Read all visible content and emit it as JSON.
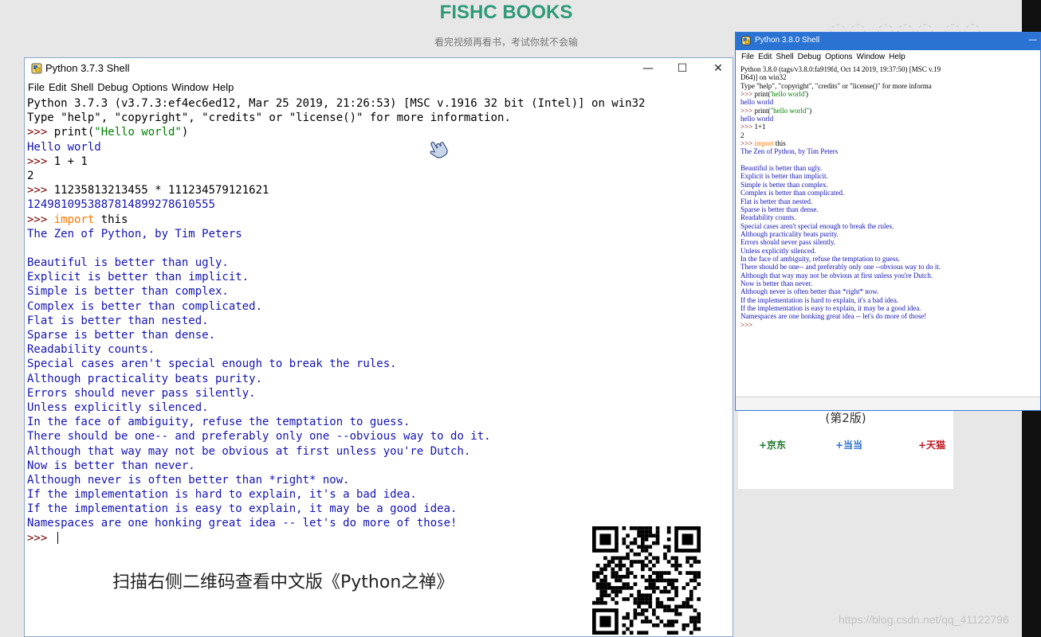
{
  "site": {
    "title": "FISHC BOOKS",
    "subtitle": "看完视频再看书，考试你就不会输"
  },
  "main_window": {
    "title": "Python 3.7.3 Shell",
    "controls": {
      "minimize": "—",
      "maximize": "☐",
      "close": "✕"
    },
    "menu": [
      "File",
      "Edit",
      "Shell",
      "Debug",
      "Options",
      "Window",
      "Help"
    ],
    "lines": [
      {
        "t": "plain",
        "text": "Python 3.7.3 (v3.7.3:ef4ec6ed12, Mar 25 2019, 21:26:53) [MSC v.1916 32 bit (Intel)] on win32"
      },
      {
        "t": "plain",
        "text": "Type \"help\", \"copyright\", \"credits\" or \"license()\" for more information."
      },
      {
        "t": "cmd",
        "prompt": ">>> ",
        "pre": "print(",
        "str": "\"Hello world\"",
        "post": ")"
      },
      {
        "t": "out",
        "text": "Hello world"
      },
      {
        "t": "in",
        "prompt": ">>> ",
        "text": "1 + 1"
      },
      {
        "t": "plain",
        "text": "2"
      },
      {
        "t": "in",
        "prompt": ">>> ",
        "text": "11235813213455 * 111234579121621"
      },
      {
        "t": "out",
        "text": "1249810953887814899278610555"
      },
      {
        "t": "kw",
        "prompt": ">>> ",
        "kw": "import",
        "text": " this"
      },
      {
        "t": "out",
        "text": "The Zen of Python, by Tim Peters"
      },
      {
        "t": "out",
        "text": ""
      },
      {
        "t": "out",
        "text": "Beautiful is better than ugly."
      },
      {
        "t": "out",
        "text": "Explicit is better than implicit."
      },
      {
        "t": "out",
        "text": "Simple is better than complex."
      },
      {
        "t": "out",
        "text": "Complex is better than complicated."
      },
      {
        "t": "out",
        "text": "Flat is better than nested."
      },
      {
        "t": "out",
        "text": "Sparse is better than dense."
      },
      {
        "t": "out",
        "text": "Readability counts."
      },
      {
        "t": "out",
        "text": "Special cases aren't special enough to break the rules."
      },
      {
        "t": "out",
        "text": "Although practicality beats purity."
      },
      {
        "t": "out",
        "text": "Errors should never pass silently."
      },
      {
        "t": "out",
        "text": "Unless explicitly silenced."
      },
      {
        "t": "out",
        "text": "In the face of ambiguity, refuse the temptation to guess."
      },
      {
        "t": "out",
        "text": "There should be one-- and preferably only one --obvious way to do it."
      },
      {
        "t": "out",
        "text": "Although that way may not be obvious at first unless you're Dutch."
      },
      {
        "t": "out",
        "text": "Now is better than never."
      },
      {
        "t": "out",
        "text": "Although never is often better than *right* now."
      },
      {
        "t": "out",
        "text": "If the implementation is hard to explain, it's a bad idea."
      },
      {
        "t": "out",
        "text": "If the implementation is easy to explain, it may be a good idea."
      },
      {
        "t": "out",
        "text": "Namespaces are one honking great idea -- let's do more of those!"
      },
      {
        "t": "prompt",
        "prompt": ">>> "
      }
    ]
  },
  "caption": "扫描右侧二维码查看中文版《Python之禅》",
  "second_window": {
    "title": "Python 3.8.0 Shell",
    "menu": [
      "File",
      "Edit",
      "Shell",
      "Debug",
      "Options",
      "Window",
      "Help"
    ],
    "lines": [
      {
        "t": "plain",
        "text": "Python 3.8.0 (tags/v3.8.0:fa919fd, Oct 14 2019, 19:37:50) [MSC v.19"
      },
      {
        "t": "plain",
        "text": "D64)] on win32"
      },
      {
        "t": "plain",
        "text": "Type \"help\", \"copyright\", \"credits\" or \"license()\" for more informa"
      },
      {
        "t": "cmd",
        "prompt": ">>> ",
        "pre": "print(",
        "str": "'hello world'",
        "post": ")"
      },
      {
        "t": "out",
        "text": "hello world"
      },
      {
        "t": "cmd",
        "prompt": ">>> ",
        "pre": "print(",
        "str": "\"hello world\"",
        "post": ")"
      },
      {
        "t": "out",
        "text": "hello world"
      },
      {
        "t": "in",
        "prompt": ">>> ",
        "text": "1+1"
      },
      {
        "t": "plain",
        "text": "2"
      },
      {
        "t": "kw",
        "prompt": ">>> ",
        "kw": "import",
        "text": " this"
      },
      {
        "t": "out",
        "text": "The Zen of Python, by Tim Peters"
      },
      {
        "t": "out",
        "text": ""
      },
      {
        "t": "out",
        "text": "Beautiful is better than ugly."
      },
      {
        "t": "out",
        "text": "Explicit is better than implicit."
      },
      {
        "t": "out",
        "text": "Simple is better than complex."
      },
      {
        "t": "out",
        "text": "Complex is better than complicated."
      },
      {
        "t": "out",
        "text": "Flat is better than nested."
      },
      {
        "t": "out",
        "text": "Sparse is better than dense."
      },
      {
        "t": "out",
        "text": "Readability counts."
      },
      {
        "t": "out",
        "text": "Special cases aren't special enough to break the rules."
      },
      {
        "t": "out",
        "text": "Although practicality beats purity."
      },
      {
        "t": "out",
        "text": "Errors should never pass silently."
      },
      {
        "t": "out",
        "text": "Unless explicitly silenced."
      },
      {
        "t": "out",
        "text": "In the face of ambiguity, refuse the temptation to guess."
      },
      {
        "t": "out",
        "text": "There should be one-- and preferably only one --obvious way to do it."
      },
      {
        "t": "out",
        "text": "Although that way may not be obvious at first unless you're Dutch."
      },
      {
        "t": "out",
        "text": "Now is better than never."
      },
      {
        "t": "out",
        "text": "Although never is often better than *right* now."
      },
      {
        "t": "out",
        "text": "If the implementation is hard to explain, it's a bad idea."
      },
      {
        "t": "out",
        "text": "If the implementation is easy to explain, it may be a good idea."
      },
      {
        "t": "out",
        "text": "Namespaces are one honking great idea -- let's do more of those!"
      },
      {
        "t": "prompt",
        "prompt": ">>>"
      }
    ]
  },
  "book_card": {
    "edition": "(第2版)",
    "stores": [
      "+京东",
      "+当当",
      "+天猫"
    ]
  },
  "watermark": "https://blog.csdn.net/qq_41122796"
}
